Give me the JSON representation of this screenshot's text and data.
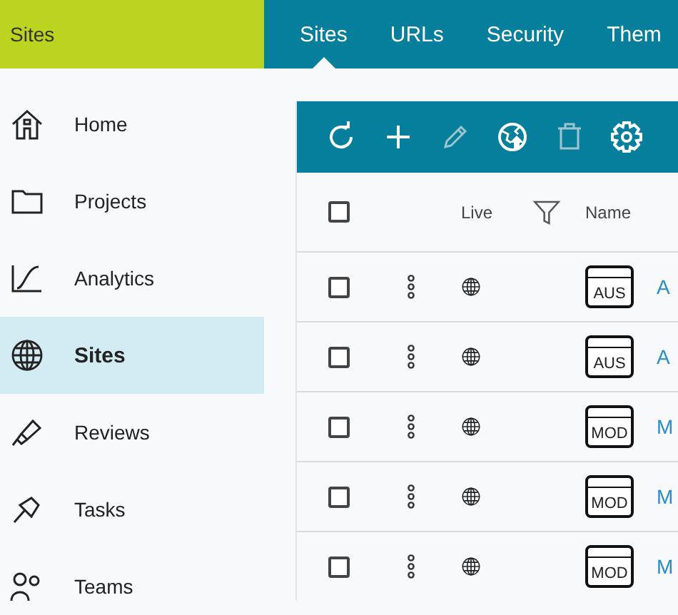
{
  "header": {
    "title": "Sites"
  },
  "tabs": [
    {
      "label": "Sites",
      "selected": true
    },
    {
      "label": "URLs",
      "selected": false
    },
    {
      "label": "Security",
      "selected": false
    },
    {
      "label": "Them",
      "selected": false
    }
  ],
  "sidebar": {
    "items": [
      {
        "label": "Home",
        "kind": "home",
        "selected": false
      },
      {
        "label": "Projects",
        "kind": "folder",
        "selected": false
      },
      {
        "label": "Analytics",
        "kind": "chart",
        "selected": false
      },
      {
        "label": "Sites",
        "kind": "globe",
        "selected": true
      },
      {
        "label": "Reviews",
        "kind": "marker",
        "selected": false
      },
      {
        "label": "Tasks",
        "kind": "pin",
        "selected": false
      },
      {
        "label": "Teams",
        "kind": "people",
        "selected": false
      }
    ]
  },
  "toolbar": {
    "buttons": [
      {
        "kind": "refresh",
        "disabled": false
      },
      {
        "kind": "add",
        "disabled": false
      },
      {
        "kind": "edit",
        "disabled": true
      },
      {
        "kind": "publish",
        "disabled": false
      },
      {
        "kind": "delete",
        "disabled": true
      },
      {
        "kind": "settings",
        "disabled": false
      }
    ]
  },
  "table": {
    "select_all": {
      "checked": false
    },
    "columns": [
      {
        "label": "Live"
      },
      {
        "label": "Name"
      }
    ],
    "rows": [
      {
        "checked": false,
        "badge": "AUS",
        "name": "A"
      },
      {
        "checked": false,
        "badge": "AUS",
        "name": "A"
      },
      {
        "checked": false,
        "badge": "MOD",
        "name": "M"
      },
      {
        "checked": false,
        "badge": "MOD",
        "name": "M"
      },
      {
        "checked": false,
        "badge": "MOD",
        "name": "M"
      }
    ]
  }
}
